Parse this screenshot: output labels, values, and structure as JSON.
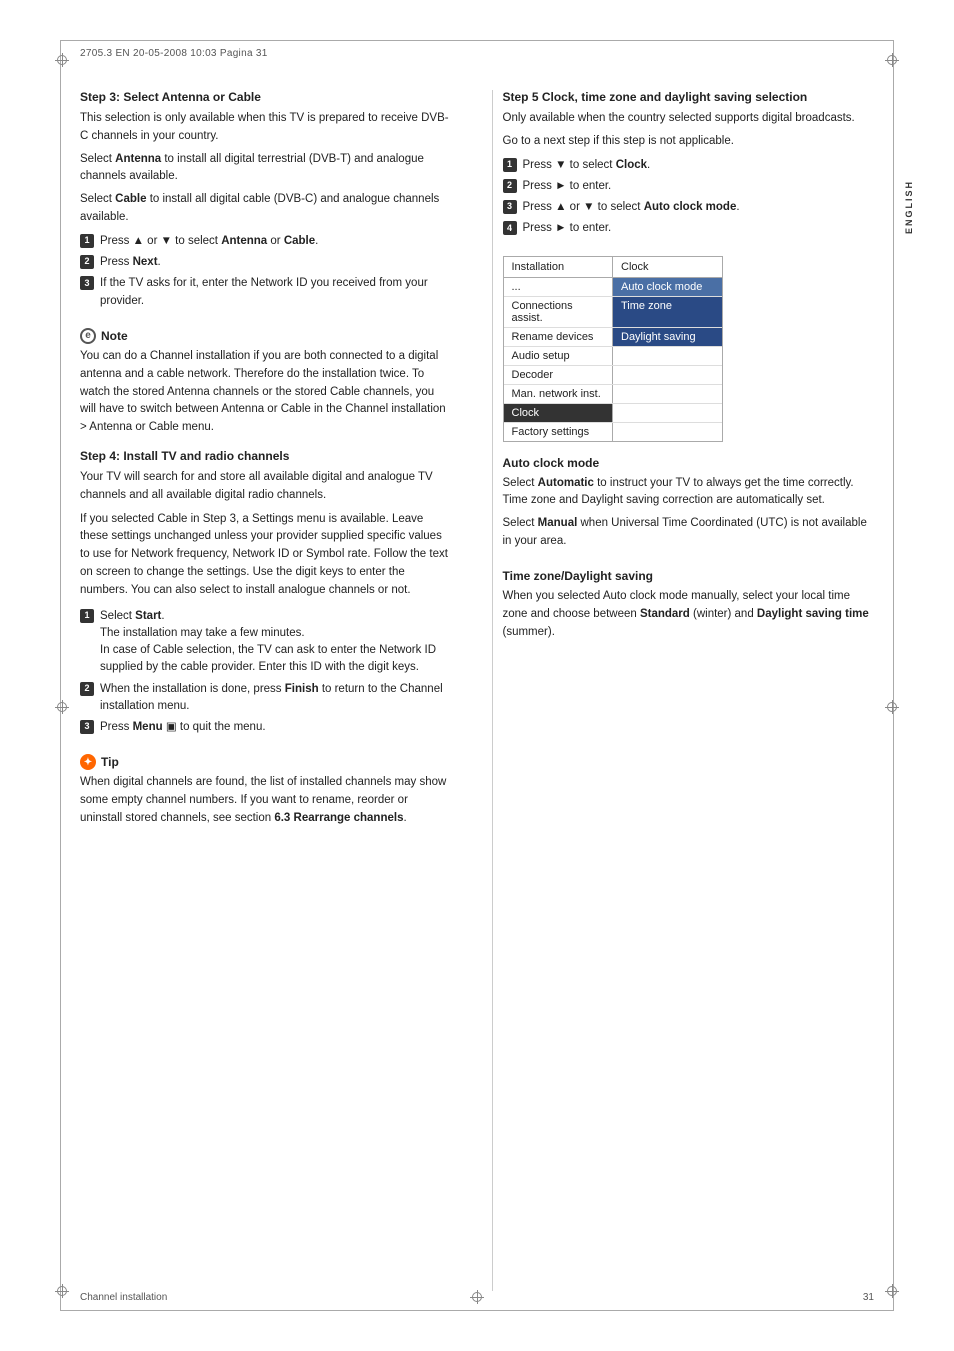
{
  "header": {
    "text": "2705.3 EN  20-05-2008  10:03   Pagina 31"
  },
  "sidebar_label": "ENGLISH",
  "footer": {
    "left": "Channel installation",
    "right": "31"
  },
  "left_column": {
    "step3": {
      "title": "Step 3:  Select Antenna or Cable",
      "para1": "This selection is only available when this TV is prepared to receive DVB-C channels in your country.",
      "para2_prefix": "Select ",
      "para2_bold": "Antenna",
      "para2_mid": " to install all digital terrestrial (DVB-T) and analogue channels available.",
      "para3_prefix": "Select ",
      "para3_bold": "Cable",
      "para3_mid": " to install all digital cable (DVB-C) and analogue channels available.",
      "steps": [
        {
          "num": "1",
          "text_prefix": "Press ",
          "text_symbol": "▲ or ▼",
          "text_suffix": " to select ",
          "text_bold": "Antenna",
          "text_end": " or ",
          "text_bold2": "Cable",
          "text_final": "."
        },
        {
          "num": "2",
          "text_prefix": "Press ",
          "text_bold": "Next",
          "text_suffix": "."
        },
        {
          "num": "3",
          "text": "If the TV asks for it, enter the Network ID you received from your provider."
        }
      ]
    },
    "note": {
      "title": "Note",
      "body": "You can do a Channel installation if you are both connected to a digital antenna and a cable network. Therefore do the installation twice. To watch the stored Antenna channels or the stored Cable channels, you will have to switch between Antenna or Cable in the Channel installation > Antenna or Cable menu."
    },
    "step4": {
      "title": "Step 4: Install TV and radio channels",
      "para1": "Your TV will search for and store all available digital and analogue TV channels and all available digital radio channels.",
      "para2": "If you selected Cable in Step 3, a Settings menu is available. Leave these settings unchanged unless your provider supplied specific values to use for Network frequency, Network ID or Symbol rate. Follow the text on screen to change the settings. Use the digit keys to enter the numbers. You can also select to install analogue channels or not.",
      "steps": [
        {
          "num": "1",
          "text_bold": "Select Start.",
          "text_sub1": "The installation may take a few minutes.",
          "text_sub2": "In case of Cable selection, the TV can ask to enter the Network ID supplied by the cable provider. Enter this ID with the digit keys."
        },
        {
          "num": "2",
          "text_prefix": "When the installation is done, press ",
          "text_bold": "Finish",
          "text_suffix": " to return to the Channel installation menu."
        },
        {
          "num": "3",
          "text_prefix": "Press ",
          "text_bold": "Menu",
          "text_icon": "▣",
          "text_suffix": " to quit the menu."
        }
      ]
    },
    "tip": {
      "title": "Tip",
      "body_prefix": "When digital channels are found, the list of installed channels may show some empty channel numbers. If you want to rename, reorder or uninstall stored channels, see section ",
      "body_bold": "6.3 Rearrange channels",
      "body_suffix": "."
    }
  },
  "right_column": {
    "step5": {
      "title": "Step 5  Clock, time zone and daylight saving selection",
      "para1": "Only available when the country selected supports digital broadcasts.",
      "para2": "Go to a next step if this step is not applicable.",
      "steps": [
        {
          "num": "1",
          "text_prefix": "Press ",
          "text_symbol": "▼",
          "text_mid": " to select ",
          "text_bold": "Clock",
          "text_suffix": "."
        },
        {
          "num": "2",
          "text_prefix": "Press ",
          "text_symbol": "►",
          "text_suffix": " to enter."
        },
        {
          "num": "3",
          "text_prefix": "Press ",
          "text_symbol": "▲ or ▼",
          "text_mid": " to select ",
          "text_bold": "Auto clock mode",
          "text_suffix": "."
        },
        {
          "num": "4",
          "text_prefix": "Press ",
          "text_symbol": "►",
          "text_suffix": " to enter."
        }
      ]
    },
    "menu": {
      "header": [
        {
          "label": "Installation",
          "class": ""
        },
        {
          "label": "Clock",
          "class": ""
        }
      ],
      "rows": [
        {
          "left": "...",
          "right": "Auto clock mode",
          "right_class": "highlighted"
        },
        {
          "left": "Connections assist.",
          "right": "Time zone",
          "right_class": "highlighted2"
        },
        {
          "left": "Rename devices",
          "right": "Daylight saving",
          "right_class": "highlighted2"
        },
        {
          "left": "Audio setup",
          "right": "",
          "right_class": ""
        },
        {
          "left": "Decoder",
          "right": "",
          "right_class": ""
        },
        {
          "left": "Man. network inst.",
          "right": "",
          "right_class": ""
        },
        {
          "left": "Clock",
          "right": "",
          "left_class": "selected-row",
          "right_class": ""
        },
        {
          "left": "Factory settings",
          "right": "",
          "right_class": ""
        }
      ]
    },
    "auto_clock_mode": {
      "title": "Auto clock mode",
      "para1_prefix": "Select ",
      "para1_bold": "Automatic",
      "para1_mid": " to instruct your TV to always get the time correctly. Time zone and Daylight saving correction are automatically set.",
      "para2_prefix": "Select ",
      "para2_bold": "Manual",
      "para2_suffix": " when Universal Time Coordinated (UTC) is not available in your area."
    },
    "time_zone": {
      "title": "Time zone/Daylight saving",
      "para1": "When you selected Auto clock mode manually, select your local time zone and choose between ",
      "para1_bold1": "Standard",
      "para1_mid": " (winter) and ",
      "para1_bold2": "Daylight saving time",
      "para1_suffix": " (summer)."
    }
  }
}
